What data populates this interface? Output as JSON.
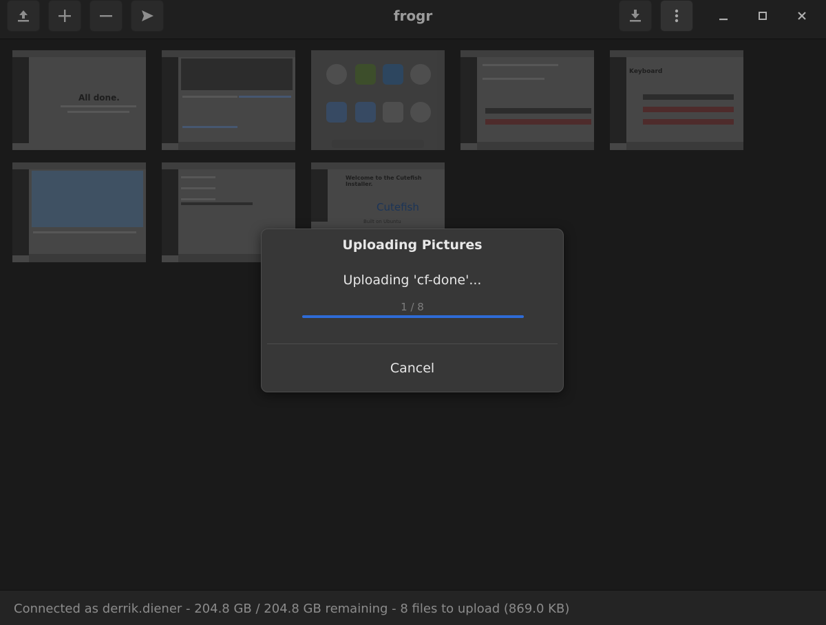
{
  "window": {
    "title": "frogr"
  },
  "toolbar": {
    "icons": [
      "upload-icon",
      "add-icon",
      "remove-icon",
      "send-icon",
      "download-icon",
      "menu-icon",
      "minimize-icon",
      "maximize-icon",
      "close-icon"
    ]
  },
  "thumbnails": [
    {
      "caption": "All done."
    },
    {
      "caption": ""
    },
    {
      "caption": ""
    },
    {
      "caption": ""
    },
    {
      "caption": "Keyboard"
    },
    {
      "caption": ""
    },
    {
      "caption": ""
    },
    {
      "caption": "Welcome to the Cutefish Installer.",
      "logo": "Cutefish",
      "subtitle": "Built on Ubuntu"
    }
  ],
  "dialog": {
    "title": "Uploading Pictures",
    "message": "Uploading 'cf-done'...",
    "progress_text": "1 / 8",
    "progress_fraction": 1.0,
    "cancel_label": "Cancel"
  },
  "status": {
    "text": "Connected as derrik.diener - 204.8 GB / 204.8 GB remaining - 8 files to upload (869.0 KB)"
  },
  "colors": {
    "accent": "#2e6bd6"
  }
}
